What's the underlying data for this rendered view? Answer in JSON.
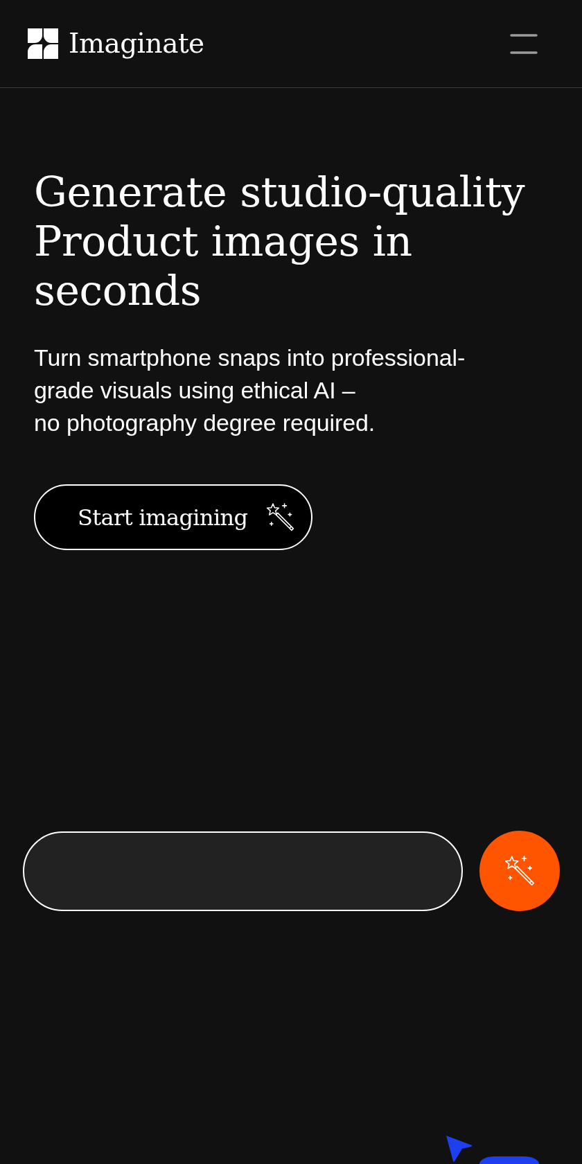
{
  "header": {
    "brand": "Imaginate"
  },
  "hero": {
    "headline_lines": [
      "Generate studio-quality",
      "Product images in",
      "seconds"
    ],
    "subtitle_lines": [
      "Turn smartphone snaps into professional-",
      "grade visuals using ethical AI –",
      "no photography degree required."
    ],
    "cta": "Start imagining"
  }
}
